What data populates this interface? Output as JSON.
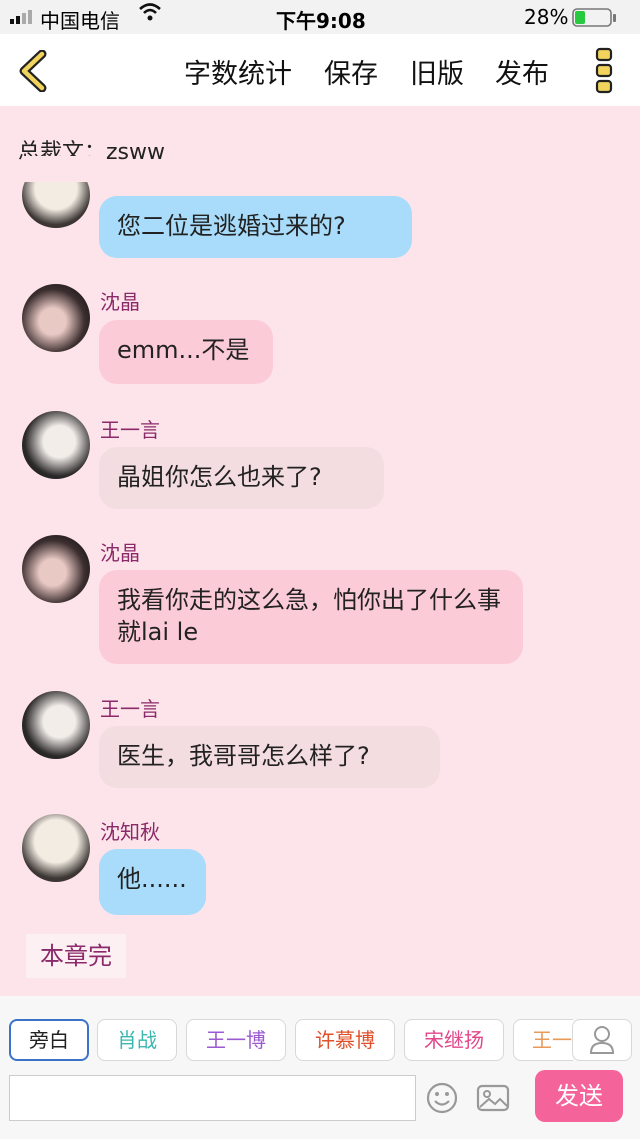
{
  "status": {
    "carrier": "中国电信",
    "time": "下午9:08",
    "battery": "28%"
  },
  "header": {
    "word_count": "字数统计",
    "save": "保存",
    "old_version": "旧版",
    "publish": "发布"
  },
  "doc_title": "总裁文：zsww",
  "messages": [
    {
      "speaker": "",
      "text": "您二位是逃婚过来的?",
      "style": "blue"
    },
    {
      "speaker": "沈晶",
      "text": "emm...不是",
      "style": "pink"
    },
    {
      "speaker": "王一言",
      "text": "晶姐你怎么也来了?",
      "style": "grey"
    },
    {
      "speaker": "沈晶",
      "text": "我看你走的这么急，怕你出了什么事就lai le",
      "style": "pink"
    },
    {
      "speaker": "王一言",
      "text": "医生，我哥哥怎么样了?",
      "style": "grey"
    },
    {
      "speaker": "沈知秋",
      "text": "他......",
      "style": "blue"
    }
  ],
  "chapter_end": "本章完",
  "characters": [
    {
      "label": "旁白",
      "color": "#222222"
    },
    {
      "label": "肖战",
      "color": "#3bb7b0"
    },
    {
      "label": "王一博",
      "color": "#9a5bd0"
    },
    {
      "label": "许慕博",
      "color": "#e0502a"
    },
    {
      "label": "宋继扬",
      "color": "#e2478a"
    },
    {
      "label": "王一",
      "color": "#e89a5a"
    }
  ],
  "input": {
    "placeholder": ""
  },
  "send_label": "发送"
}
